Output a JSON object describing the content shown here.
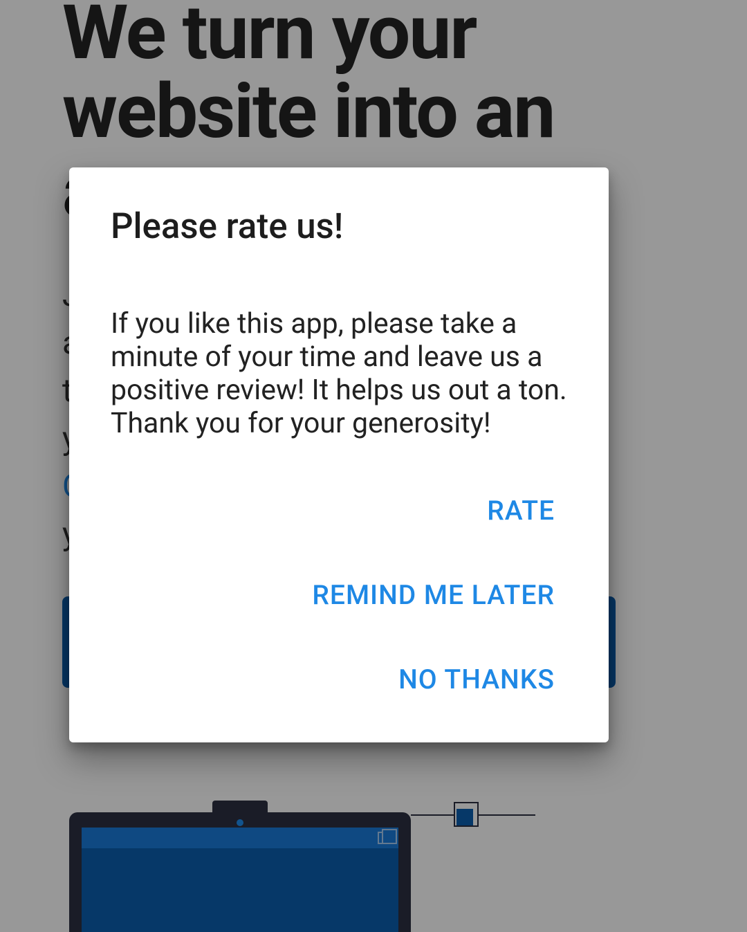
{
  "background": {
    "heading": "We turn your website into an app",
    "button_label": "",
    "colors": {
      "accent": "#0a5ba8",
      "link": "#1e88e5"
    }
  },
  "dialog": {
    "title": "Please rate us!",
    "body": "If you like this app, please take a minute of your time and leave us a positive review! It helps us out a ton. Thank you for your generosity!",
    "actions": {
      "rate": "RATE",
      "remind": "REMIND ME LATER",
      "dismiss": "NO THANKS"
    }
  }
}
